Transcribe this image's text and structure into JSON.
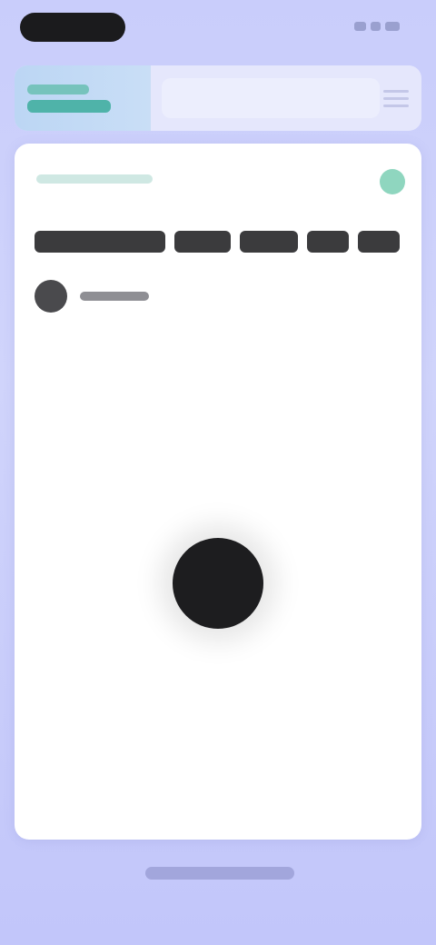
{
  "status_bar": {
    "time_pill": "dark",
    "icons": [
      "signal-icon",
      "wifi-icon",
      "battery-icon"
    ]
  },
  "header": {
    "logo_icon": "app-logo-icon",
    "search_icon": "search-field",
    "menu_icon": "menu-icon"
  },
  "card": {
    "share_icon": "share-icon",
    "avatar_icon": "avatar",
    "media_icon": "record-dot-icon"
  },
  "colors": {
    "background": "#c9cdfb",
    "header_bg": "#e5e7fc",
    "logo_accent": "#4fb3a9",
    "card_bg": "#ffffff",
    "title_text": "#3b3b3d",
    "media_dot": "#1d1d1f",
    "home_indicator": "#a2a6dc"
  }
}
